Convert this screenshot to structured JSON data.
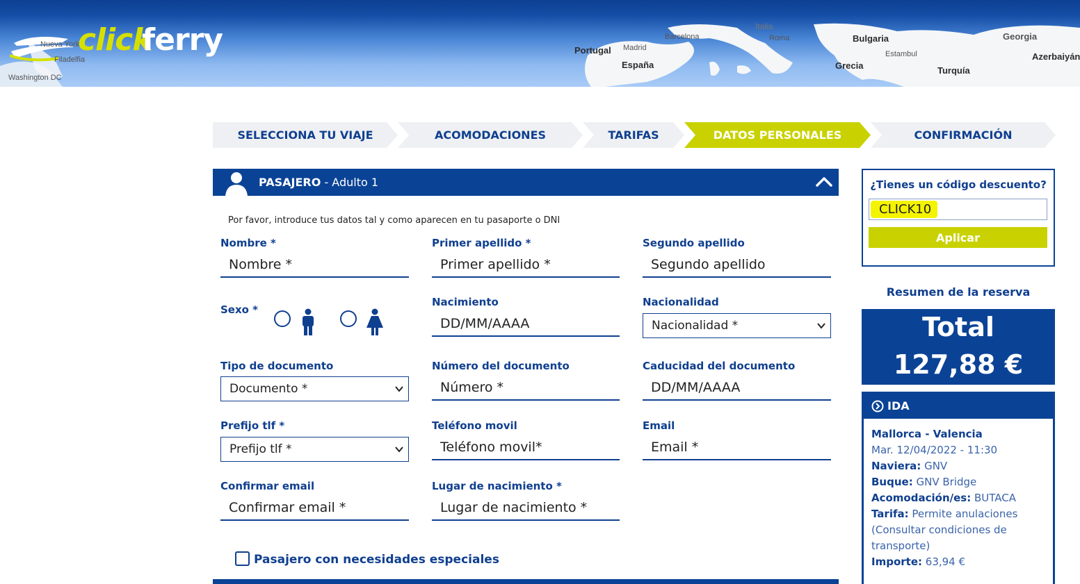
{
  "brand": {
    "click": "click",
    "ferry": "ferry"
  },
  "map_labels": {
    "nueva_york": "Nueva York",
    "filadelfia": "Filadelfia",
    "washington": "Washington DC",
    "portugal": "Portugal",
    "madrid": "Madrid",
    "espana": "España",
    "barcelona": "Barcelona",
    "italia": "Italia",
    "roma": "Roma",
    "bulgaria": "Bulgaria",
    "estambul": "Estambul",
    "grecia": "Grecia",
    "turquia": "Turquía",
    "georgia": "Georgia",
    "azerbaiyan": "Azerbaiyán"
  },
  "steps": [
    {
      "label": "SELECCIONA TU VIAJE"
    },
    {
      "label": "ACOMODACIONES"
    },
    {
      "label": "TARIFAS"
    },
    {
      "label": "DATOS PERSONALES"
    },
    {
      "label": "CONFIRMACIÓN"
    }
  ],
  "passenger": {
    "title": "PASAJERO",
    "subtitle": " - Adulto 1",
    "note": "Por favor, introduce tus datos tal y como aparecen en tu pasaporte o DNI"
  },
  "form": {
    "nombre": {
      "label": "Nombre *",
      "placeholder": "Nombre *"
    },
    "primer_apellido": {
      "label": "Primer apellido *",
      "placeholder": "Primer apellido *"
    },
    "segundo_apellido": {
      "label": "Segundo apellido",
      "placeholder": "Segundo apellido"
    },
    "sexo": {
      "label": "Sexo *"
    },
    "nacimiento": {
      "label": "Nacimiento",
      "placeholder": "DD/MM/AAAA"
    },
    "nacionalidad": {
      "label": "Nacionalidad",
      "selected": "Nacionalidad *"
    },
    "tipo_documento": {
      "label": "Tipo de documento",
      "selected": "Documento *"
    },
    "numero_documento": {
      "label": "Número del documento",
      "placeholder": "Número *"
    },
    "caducidad": {
      "label": "Caducidad del documento",
      "placeholder": "DD/MM/AAAA"
    },
    "prefijo": {
      "label": "Prefijo tlf *",
      "selected": "Prefijo tlf *"
    },
    "telefono": {
      "label": "Teléfono movil",
      "placeholder": "Teléfono movil*"
    },
    "email": {
      "label": "Email",
      "placeholder": "Email *"
    },
    "confirmar_email": {
      "label": "Confirmar email",
      "placeholder": "Confirmar email *"
    },
    "lugar_nacimiento": {
      "label": "Lugar de nacimiento *",
      "placeholder": "Lugar de nacimiento *"
    },
    "necesidades": {
      "label": "Pasajero con necesidades especiales"
    }
  },
  "coupon": {
    "title": "¿Tienes un código descuento?",
    "value": "CLICK10",
    "apply_label": "Aplicar"
  },
  "summary": {
    "title": "Resumen de la reserva",
    "total_label": "Total",
    "total_value": "127,88 €"
  },
  "ida": {
    "header": "IDA",
    "route": "Mallorca - Valencia",
    "date": "Mar. 12/04/2022 - 11:30",
    "naviera_label": "Naviera:",
    "naviera": "GNV",
    "buque_label": "Buque:",
    "buque": "GNV Bridge",
    "acomodacion_label": "Acomodación/es:",
    "acomodacion": "BUTACA",
    "tarifa_label": "Tarifa:",
    "tarifa_1": "Permite anulaciones",
    "tarifa_2": "(Consultar condiciones de",
    "tarifa_3": "transporte)",
    "importe_label": "Importe:",
    "importe": "63,94 €"
  },
  "colors": {
    "primary": "#0a4396",
    "accent": "#c9d200",
    "highlight": "#f4f400"
  }
}
